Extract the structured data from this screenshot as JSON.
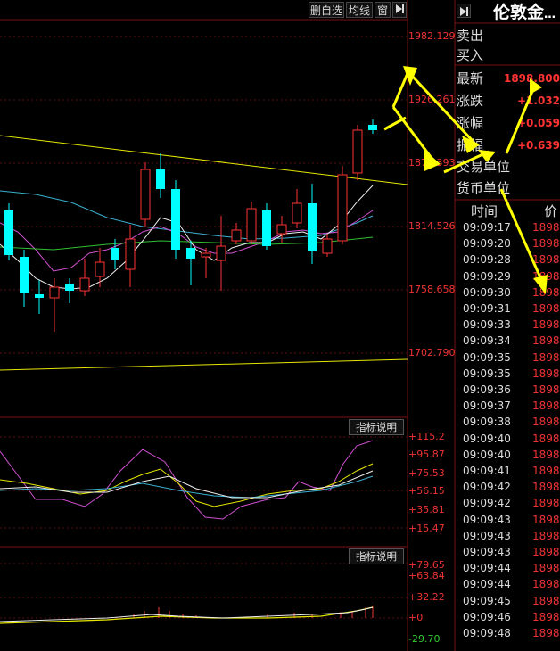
{
  "toolbar": {
    "delete_watch": "删自选",
    "ma_lines": "均线",
    "window": "窗",
    "arrow_icon": "play-right-icon"
  },
  "price_axis": [
    "1982.129",
    "1926.261",
    "1870.393",
    "1814.526",
    "1758.658",
    "1702.790"
  ],
  "macd_panel": {
    "button": "指标说明",
    "axis": [
      "+115.2",
      "+95.87",
      "+75.53",
      "+56.15",
      "+35.81",
      "+15.47"
    ]
  },
  "lower_panel": {
    "button": "指标说明",
    "axis": [
      "+79.65",
      "+63.84",
      "+32.22",
      "+0",
      "-29.70"
    ]
  },
  "quote": {
    "title": "伦敦金",
    "title_suffix": "…",
    "arrow_icon": "play-right-icon",
    "sell": "卖出",
    "buy": "买入",
    "latest_label": "最新",
    "latest_value": "1898.800",
    "change_label": "涨跌",
    "change_value": "+1.032",
    "change_pct_label": "涨幅",
    "change_pct_value": "+0.059",
    "amplitude_label": "振幅",
    "amplitude_value": "+0.639",
    "trade_unit": "交易单位",
    "currency_unit": "货币单位"
  },
  "ticks": {
    "time_header": "时间",
    "price_header": "价",
    "rows": [
      {
        "time": "09:09:17",
        "price": "1898."
      },
      {
        "time": "09:09:20",
        "price": "1898."
      },
      {
        "time": "09:09:28",
        "price": "1898."
      },
      {
        "time": "09:09:29",
        "price": "1898."
      },
      {
        "time": "09:09:30",
        "price": "1898."
      },
      {
        "time": "09:09:31",
        "price": "1898."
      },
      {
        "time": "09:09:33",
        "price": "1898."
      },
      {
        "time": "09:09:34",
        "price": "1898."
      },
      {
        "time": "09:09:35",
        "price": "1898."
      },
      {
        "time": "09:09:35",
        "price": "1898."
      },
      {
        "time": "09:09:36",
        "price": "1898."
      },
      {
        "time": "09:09:37",
        "price": "1898."
      },
      {
        "time": "09:09:38",
        "price": "1898."
      },
      {
        "time": "09:09:40",
        "price": "1898."
      },
      {
        "time": "09:09:40",
        "price": "1898."
      },
      {
        "time": "09:09:41",
        "price": "1898."
      },
      {
        "time": "09:09:42",
        "price": "1898."
      },
      {
        "time": "09:09:42",
        "price": "1898."
      },
      {
        "time": "09:09:43",
        "price": "1898."
      },
      {
        "time": "09:09:43",
        "price": "1898."
      },
      {
        "time": "09:09:43",
        "price": "1898."
      },
      {
        "time": "09:09:44",
        "price": "1898."
      },
      {
        "time": "09:09:44",
        "price": "1898."
      },
      {
        "time": "09:09:45",
        "price": "1898."
      },
      {
        "time": "09:09:46",
        "price": "1898."
      },
      {
        "time": "09:09:48",
        "price": "1898."
      }
    ]
  },
  "colors": {
    "up": "#ff3333",
    "down": "#00ffff",
    "grid": "#7a1010",
    "annotation": "#ffff00"
  }
}
